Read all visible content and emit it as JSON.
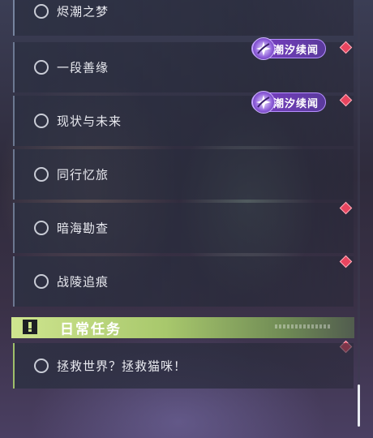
{
  "quests": [
    {
      "label": "烬潮之梦"
    },
    {
      "label": "一段善缘"
    },
    {
      "label": "现状与未来"
    },
    {
      "label": "同行忆旅"
    },
    {
      "label": "暗海勘查"
    },
    {
      "label": "战陵追痕"
    }
  ],
  "badges": [
    {
      "text": "潮汐续闻",
      "icon": "tide-sparkle-icon"
    },
    {
      "text": "潮汐续闻",
      "icon": "tide-sparkle-icon"
    }
  ],
  "daily_section": {
    "title": "日常任务",
    "icon": "exclamation-icon",
    "accent": "#cfe58f",
    "quests": [
      {
        "label": "拯救世界？拯救猫咪！"
      }
    ]
  },
  "colors": {
    "badge_purple": "#7a3fc4",
    "marker_red": "#e8455f"
  }
}
